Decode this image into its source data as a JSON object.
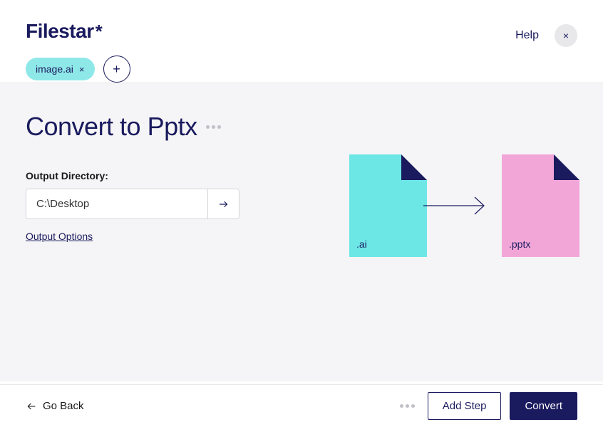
{
  "header": {
    "logo": "Filestar",
    "logo_suffix": "*",
    "help_label": "Help",
    "close_label": "×"
  },
  "chips": {
    "file": "image.ai",
    "remove": "×",
    "add": "+"
  },
  "page": {
    "title": "Convert to Pptx"
  },
  "output": {
    "label": "Output Directory:",
    "value": "C:\\Desktop",
    "options_link": "Output Options"
  },
  "preview": {
    "source_ext": ".ai",
    "target_ext": ".pptx"
  },
  "footer": {
    "back_label": "Go Back",
    "add_step_label": "Add Step",
    "convert_label": "Convert"
  }
}
